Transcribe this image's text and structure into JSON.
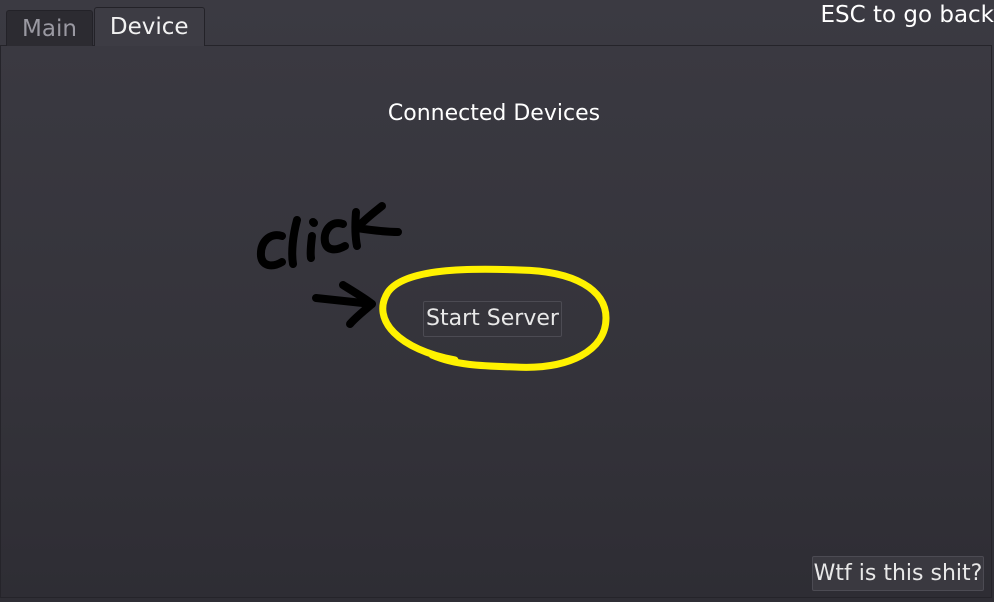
{
  "tabs": [
    {
      "label": "Main",
      "active": false
    },
    {
      "label": "Device",
      "active": true
    }
  ],
  "esc_hint": "ESC to go back",
  "panel": {
    "title": "Connected Devices",
    "start_button": "Start Server",
    "help_button": "Wtf is this shit?"
  },
  "annotation": {
    "handwritten_text": "click",
    "arrow_color": "#000000",
    "circle_color": "#fff200"
  }
}
